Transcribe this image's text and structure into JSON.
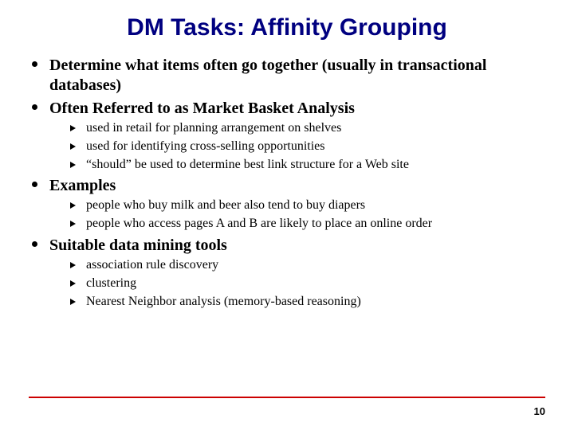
{
  "title": "DM Tasks: Affinity Grouping",
  "items": [
    {
      "text": "Determine what items often go together (usually in transactional databases)",
      "sub": []
    },
    {
      "text": "Often Referred to as Market Basket Analysis",
      "sub": [
        "used in retail for planning arrangement on shelves",
        "used for identifying cross-selling opportunities",
        "“should” be used to determine best link structure for a Web site"
      ]
    },
    {
      "text": "Examples",
      "sub": [
        "people who buy milk and beer also tend to buy diapers",
        "people who access pages A and B are likely to place an online order"
      ]
    },
    {
      "text": "Suitable data mining tools",
      "sub": [
        "association rule discovery",
        "clustering",
        "Nearest Neighbor analysis (memory-based reasoning)"
      ]
    }
  ],
  "page_number": "10"
}
